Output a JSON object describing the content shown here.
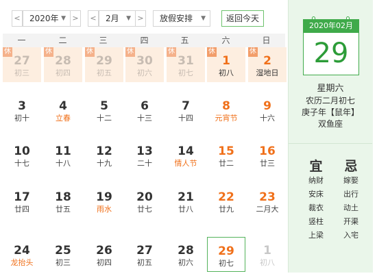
{
  "toolbar": {
    "year_prev": "<",
    "year_label": "2020年",
    "year_caret": "▼",
    "year_next": ">",
    "month_prev": "<",
    "month_label": "2月",
    "month_caret": "▼",
    "month_next": ">",
    "holiday_label": "放假安排",
    "holiday_caret": "▼",
    "today_button": "返回今天"
  },
  "weekdays": [
    "一",
    "二",
    "三",
    "四",
    "五",
    "六",
    "日"
  ],
  "holiday_badge": "休",
  "rows": [
    [
      {
        "day": "27",
        "lunar": "初三",
        "type": "other",
        "holiday": true
      },
      {
        "day": "28",
        "lunar": "初四",
        "type": "other",
        "holiday": true
      },
      {
        "day": "29",
        "lunar": "初五",
        "type": "other",
        "holiday": true
      },
      {
        "day": "30",
        "lunar": "初六",
        "type": "other",
        "holiday": true
      },
      {
        "day": "31",
        "lunar": "初七",
        "type": "other",
        "holiday": true
      },
      {
        "day": "1",
        "lunar": "初八",
        "type": "weekend",
        "holiday": true
      },
      {
        "day": "2",
        "lunar": "湿地日",
        "type": "weekend",
        "holiday": true
      }
    ],
    [
      {
        "day": "3",
        "lunar": "初十",
        "type": "normal"
      },
      {
        "day": "4",
        "lunar": "立春",
        "type": "normal",
        "festival": true
      },
      {
        "day": "5",
        "lunar": "十二",
        "type": "normal"
      },
      {
        "day": "6",
        "lunar": "十三",
        "type": "normal"
      },
      {
        "day": "7",
        "lunar": "十四",
        "type": "normal"
      },
      {
        "day": "8",
        "lunar": "元宵节",
        "type": "weekend",
        "festival": true
      },
      {
        "day": "9",
        "lunar": "十六",
        "type": "weekend"
      }
    ],
    [
      {
        "day": "10",
        "lunar": "十七",
        "type": "normal"
      },
      {
        "day": "11",
        "lunar": "十八",
        "type": "normal"
      },
      {
        "day": "12",
        "lunar": "十九",
        "type": "normal"
      },
      {
        "day": "13",
        "lunar": "二十",
        "type": "normal"
      },
      {
        "day": "14",
        "lunar": "情人节",
        "type": "normal",
        "festival": true
      },
      {
        "day": "15",
        "lunar": "廿二",
        "type": "weekend"
      },
      {
        "day": "16",
        "lunar": "廿三",
        "type": "weekend"
      }
    ],
    [
      {
        "day": "17",
        "lunar": "廿四",
        "type": "normal"
      },
      {
        "day": "18",
        "lunar": "廿五",
        "type": "normal"
      },
      {
        "day": "19",
        "lunar": "雨水",
        "type": "normal",
        "festival": true
      },
      {
        "day": "20",
        "lunar": "廿七",
        "type": "normal"
      },
      {
        "day": "21",
        "lunar": "廿八",
        "type": "normal"
      },
      {
        "day": "22",
        "lunar": "廿九",
        "type": "weekend"
      },
      {
        "day": "23",
        "lunar": "二月大",
        "type": "weekend"
      }
    ],
    [
      {
        "day": "24",
        "lunar": "龙抬头",
        "type": "normal",
        "festival": true
      },
      {
        "day": "25",
        "lunar": "初三",
        "type": "normal"
      },
      {
        "day": "26",
        "lunar": "初四",
        "type": "normal"
      },
      {
        "day": "27",
        "lunar": "初五",
        "type": "normal"
      },
      {
        "day": "28",
        "lunar": "初六",
        "type": "normal"
      },
      {
        "day": "29",
        "lunar": "初七",
        "type": "today"
      },
      {
        "day": "1",
        "lunar": "初八",
        "type": "other"
      }
    ]
  ],
  "panel": {
    "header": "2020年02月",
    "day": "29",
    "weekday": "星期六",
    "lunar": "农历二月初七",
    "ganzhi": "庚子年【鼠年】",
    "zodiac": "双鱼座",
    "yi_title": "宜",
    "ji_title": "忌",
    "yi": [
      "纳财",
      "安床",
      "裁衣",
      "竖柱",
      "上梁"
    ],
    "ji": [
      "嫁娶",
      "出行",
      "动土",
      "开渠",
      "入宅"
    ]
  },
  "colors": {
    "accent_green": "#3faa4a",
    "holiday_bg": "#fdeee0",
    "weekend_orange": "#f0701a",
    "panel_bg": "#eaf6ea"
  }
}
